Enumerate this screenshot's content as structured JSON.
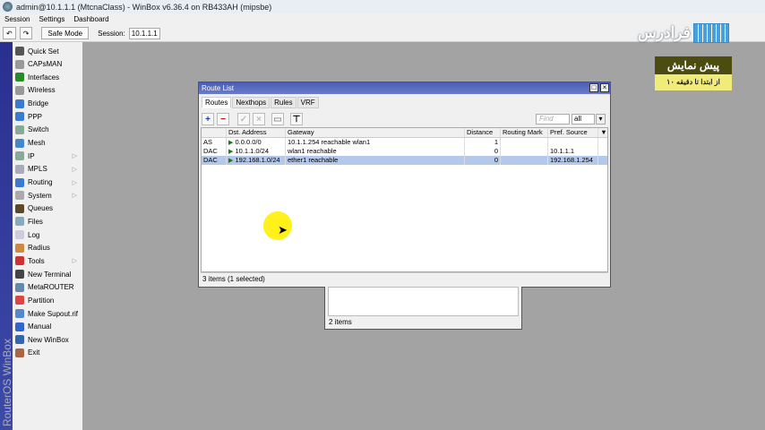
{
  "window": {
    "title": "admin@10.1.1.1 (MtcnaClass) - WinBox v6.36.4 on RB433AH (mipsbe)"
  },
  "menubar": [
    "Session",
    "Settings",
    "Dashboard"
  ],
  "toolbar": {
    "undo": "↶",
    "redo": "↷",
    "safe_mode": "Safe Mode",
    "session_label": "Session:",
    "session_value": "10.1.1.1"
  },
  "sidebar": {
    "brand": "RouterOS WinBox",
    "items": [
      {
        "label": "Quick Set",
        "color": "#555"
      },
      {
        "label": "CAPsMAN",
        "color": "#999"
      },
      {
        "label": "Interfaces",
        "color": "#2a8a2a"
      },
      {
        "label": "Wireless",
        "color": "#999"
      },
      {
        "label": "Bridge",
        "color": "#3a7ad0"
      },
      {
        "label": "PPP",
        "color": "#3a7ad0"
      },
      {
        "label": "Switch",
        "color": "#8a9"
      },
      {
        "label": "Mesh",
        "color": "#48c"
      },
      {
        "label": "IP",
        "color": "#8a9",
        "sub": true
      },
      {
        "label": "MPLS",
        "color": "#aab",
        "sub": true
      },
      {
        "label": "Routing",
        "color": "#3a7ad0",
        "sub": true
      },
      {
        "label": "System",
        "color": "#aaa",
        "sub": true
      },
      {
        "label": "Queues",
        "color": "#5a4a2a"
      },
      {
        "label": "Files",
        "color": "#8ab"
      },
      {
        "label": "Log",
        "color": "#ccd"
      },
      {
        "label": "Radius",
        "color": "#c84"
      },
      {
        "label": "Tools",
        "color": "#c33",
        "sub": true
      },
      {
        "label": "New Terminal",
        "color": "#444"
      },
      {
        "label": "MetaROUTER",
        "color": "#68a"
      },
      {
        "label": "Partition",
        "color": "#d44"
      },
      {
        "label": "Make Supout.rif",
        "color": "#58c"
      },
      {
        "label": "Manual",
        "color": "#36c"
      },
      {
        "label": "New WinBox",
        "color": "#36a"
      },
      {
        "label": "Exit",
        "color": "#a64"
      }
    ]
  },
  "route_list": {
    "title": "Route List",
    "tabs": [
      "Routes",
      "Nexthops",
      "Rules",
      "VRF"
    ],
    "find_placeholder": "Find",
    "filter_value": "all",
    "columns": [
      "",
      "Dst. Address",
      "Gateway",
      "Distance",
      "Routing Mark",
      "Pref. Source"
    ],
    "rows": [
      {
        "flags": "AS",
        "dst": "0.0.0.0/0",
        "gateway": "10.1.1.254 reachable wlan1",
        "distance": "1",
        "mark": "",
        "pref": ""
      },
      {
        "flags": "DAC",
        "dst": "10.1.1.0/24",
        "gateway": "wlan1 reachable",
        "distance": "0",
        "mark": "",
        "pref": "10.1.1.1"
      },
      {
        "flags": "DAC",
        "dst": "192.168.1.0/24",
        "gateway": "ether1 reachable",
        "distance": "0",
        "mark": "",
        "pref": "192.168.1.254",
        "selected": true
      }
    ],
    "status": "3 items (1 selected)"
  },
  "back_window": {
    "status": "2 items"
  },
  "overlay": {
    "logo": "فرادرس",
    "promo_title": "پیش نمایش",
    "promo_sub": "از ابتدا تا دقیقه ۱۰"
  }
}
